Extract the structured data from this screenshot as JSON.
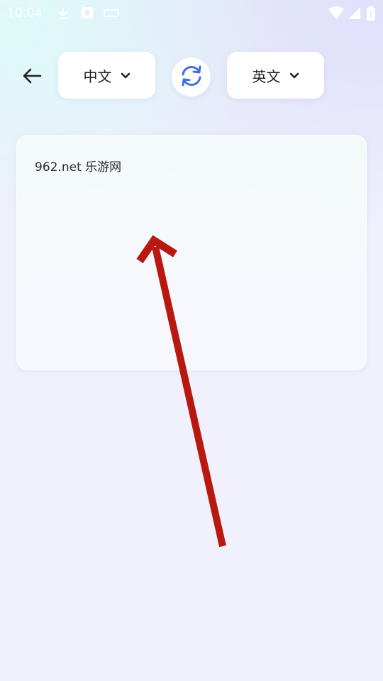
{
  "status_bar": {
    "time": "10:04",
    "icons": [
      "download-icon",
      "notification-app-icon",
      "sim-icon",
      "wifi-icon",
      "cell-signal-icon",
      "battery-icon"
    ]
  },
  "header": {
    "back_icon": "arrow-left-icon",
    "source_language": "中文",
    "target_language": "英文",
    "swap_icon": "sync-swap-icon",
    "dropdown_icon": "chevron-down-icon"
  },
  "card": {
    "text": "962.net 乐游网"
  },
  "colors": {
    "accent_blue": "#3f6fe0",
    "annotation_red": "#b8180f",
    "card_bg": "#f5f8fc",
    "page_bg": "#f1f1fc"
  }
}
